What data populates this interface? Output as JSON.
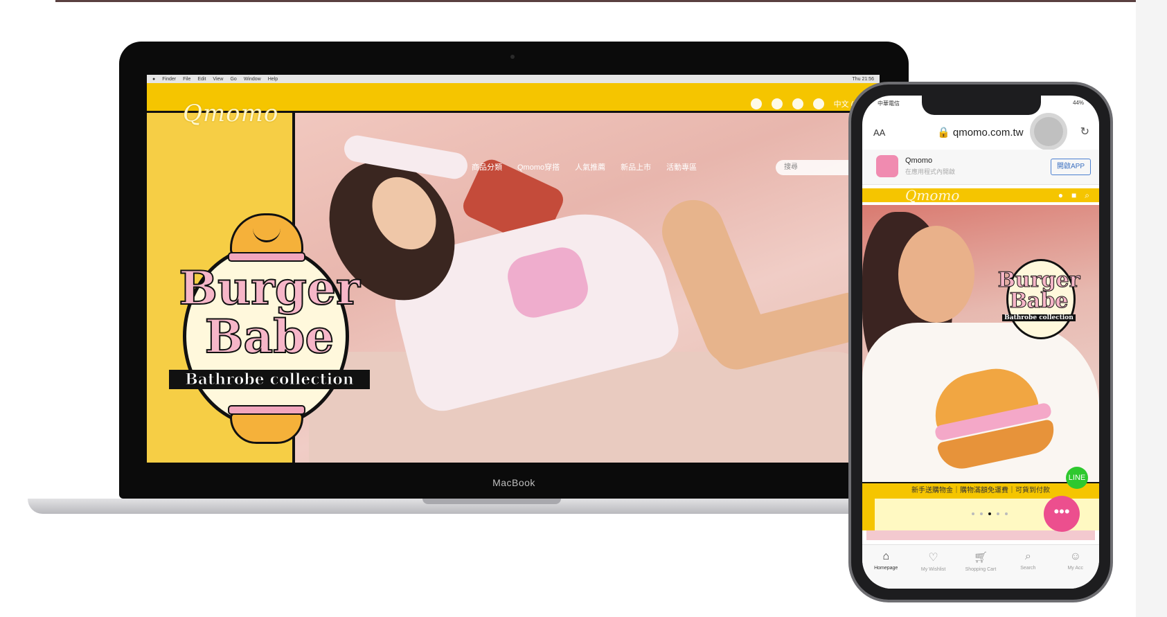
{
  "mac_menubar": {
    "apple": "",
    "items": [
      "Finder",
      "File",
      "Edit",
      "View",
      "Go",
      "Window",
      "Help"
    ],
    "right_items": [
      "Thu 21:56"
    ]
  },
  "desktop_site": {
    "logo": "Qmomo",
    "header_icons": [
      "mobile-icon",
      "user-icon",
      "cart-icon",
      "globe-icon"
    ],
    "language": "中文 (繁體)",
    "nav": [
      "商品分類",
      "Qmomo穿搭",
      "人氣推薦",
      "新品上市",
      "活動專區"
    ],
    "search_placeholder": "搜尋",
    "badge": {
      "line1": "Burger",
      "line2": "Babe",
      "subtitle": "Bathrobe collection"
    }
  },
  "laptop": {
    "brand": "MacBook"
  },
  "phone": {
    "status_left": "中華電信",
    "status_right": "44%",
    "aa_label": "AA",
    "url": "qmomo.com.tw",
    "app_banner": {
      "name": "Qmomo",
      "description": "在應用程式內開啟",
      "open_label": "開啟APP"
    },
    "logo": "Qmomo",
    "badge": {
      "line1": "Burger",
      "line2": "Babe",
      "subtitle": "Bathrobe collection"
    },
    "ticker": "新手送購物金｜購物滿額免運費｜可貨到付款",
    "carousel_active": 2,
    "line_label": "LINE",
    "chat_label": "•••",
    "tabs": [
      {
        "label": "Homepage",
        "icon": "home-icon",
        "active": true
      },
      {
        "label": "My Wishlist",
        "icon": "heart-icon",
        "active": false
      },
      {
        "label": "Shopping Cart",
        "icon": "cart-icon",
        "active": false
      },
      {
        "label": "Search",
        "icon": "search-icon",
        "active": false
      },
      {
        "label": "My Acc",
        "icon": "account-icon",
        "active": false
      }
    ]
  }
}
